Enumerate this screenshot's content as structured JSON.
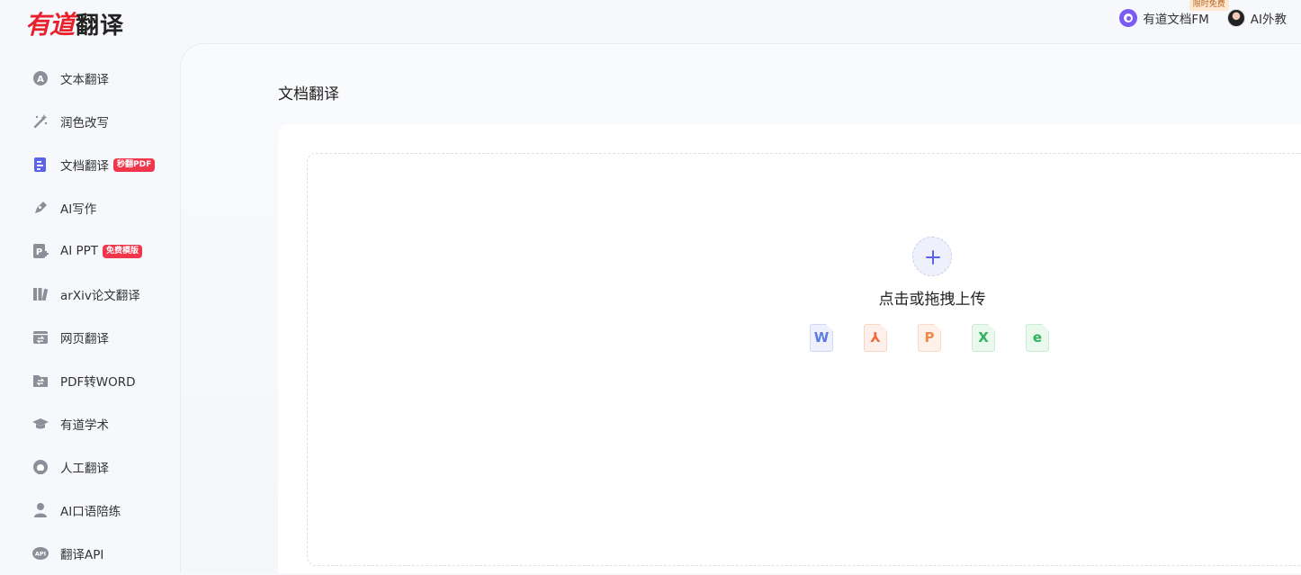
{
  "brand": {
    "logo_red": "有道",
    "logo_dark": "翻译",
    "accent": "#e8202c"
  },
  "header": {
    "fm_label": "有道文档FM",
    "fm_badge": "限时免费",
    "ai_tutor_label": "AI外教"
  },
  "sidebar": {
    "items": [
      {
        "label": "文本翻译",
        "icon": "text-translate-icon"
      },
      {
        "label": "润色改写",
        "icon": "magic-wand-icon"
      },
      {
        "label": "文档翻译",
        "icon": "document-icon",
        "badge": "秒翻PDF",
        "active": true
      },
      {
        "label": "AI写作",
        "icon": "pen-icon"
      },
      {
        "label": "AI PPT",
        "icon": "ppt-icon",
        "badge": "免费模版"
      },
      {
        "label": "arXiv论文翻译",
        "icon": "books-icon"
      },
      {
        "label": "网页翻译",
        "icon": "webpage-icon"
      },
      {
        "label": "PDF转WORD",
        "icon": "folder-convert-icon"
      },
      {
        "label": "有道学术",
        "icon": "graduation-cap-icon"
      },
      {
        "label": "人工翻译",
        "icon": "headset-icon"
      },
      {
        "label": "AI口语陪练",
        "icon": "person-icon"
      },
      {
        "label": "翻译API",
        "icon": "api-icon"
      }
    ]
  },
  "main": {
    "title": "文档翻译",
    "upload_text": "点击或拖拽上传",
    "file_types": [
      {
        "glyph": "W",
        "icon": "word-file-icon",
        "color": "#5b7be0"
      },
      {
        "glyph": "⅄",
        "icon": "pdf-file-icon",
        "color": "#f06a3b"
      },
      {
        "glyph": "P",
        "icon": "ppt-file-icon",
        "color": "#f08a4b"
      },
      {
        "glyph": "X",
        "icon": "excel-file-icon",
        "color": "#2fb35a"
      },
      {
        "glyph": "e",
        "icon": "epub-file-icon",
        "color": "#2fb35a"
      }
    ]
  }
}
